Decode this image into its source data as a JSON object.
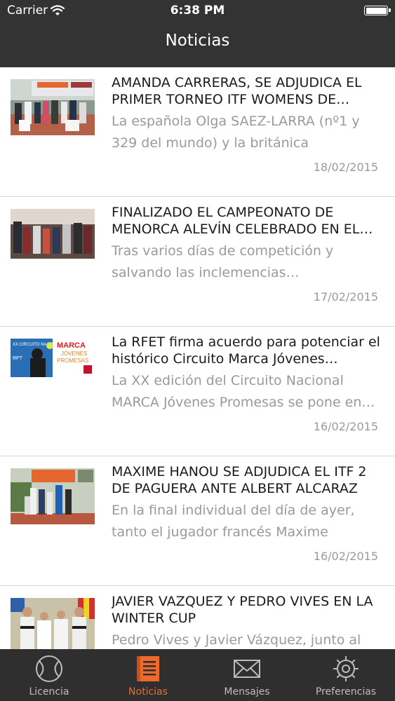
{
  "status_bar": {
    "carrier": "Carrier",
    "time": "6:38 PM"
  },
  "nav": {
    "title": "Noticias"
  },
  "news": [
    {
      "title": "AMANDA CARRERAS, SE ADJUDICA EL PRIMER TORNEO ITF WOMENS DE…",
      "summary": "La española Olga SAEZ-LARRA (nº1 y 329 del mundo) y la británica Amanda…",
      "date": "18/02/2015"
    },
    {
      "title": "FINALIZADO EL CAMPEONATO DE MENORCA ALEVÍN CELEBRADO EN EL…",
      "summary": "Tras varios días de competición y salvando las inclemencias…",
      "date": "17/02/2015"
    },
    {
      "title": "La RFET firma acuerdo para potenciar el histórico Circuito Marca Jóvenes…",
      "summary": "La XX edición del Circuito Nacional MARCA Jóvenes Promesas se pone en…",
      "date": "16/02/2015",
      "thumb_text": {
        "circuito": "XX CIRCUITO NACIONAL",
        "rpt": "RPT",
        "marca": "MARCA",
        "jovenes": "JÓVENES",
        "promesas": "PROMESAS"
      }
    },
    {
      "title": "MAXIME HANOU SE ADJUDICA EL ITF 2 DE PAGUERA ANTE ALBERT ALCARAZ",
      "summary": "En la final individual del día de ayer, tanto el jugador francés Maxime Hanou…",
      "date": "16/02/2015"
    },
    {
      "title": "JAVIER VAZQUEZ Y PEDRO VIVES EN LA WINTER CUP",
      "summary": "Pedro Vives y Javier Vázquez, junto al",
      "date": ""
    }
  ],
  "tabs": [
    {
      "label": "Licencia",
      "icon": "tennis-ball-icon",
      "active": false
    },
    {
      "label": "Noticias",
      "icon": "news-icon",
      "active": true
    },
    {
      "label": "Mensajes",
      "icon": "envelope-icon",
      "active": false
    },
    {
      "label": "Preferencias",
      "icon": "gear-icon",
      "active": false
    }
  ],
  "colors": {
    "bar": "#333333",
    "accent": "#ef6a2a",
    "inactive": "#bdbdbd",
    "summary": "#9a9a9a"
  }
}
